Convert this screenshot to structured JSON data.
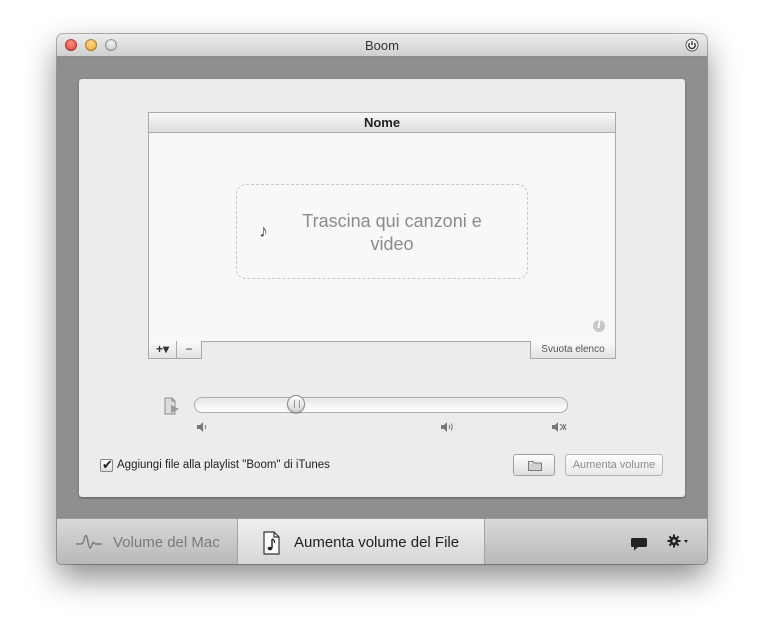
{
  "window": {
    "title": "Boom"
  },
  "table": {
    "column_header": "Nome",
    "drop_hint": "Trascina qui canzoni e video",
    "add_label": "+▾",
    "remove_label": "−",
    "clear_label": "Svuota elenco"
  },
  "volume": {
    "level": 0.26
  },
  "options": {
    "playlist_checkbox_label": "Aggiungi file alla playlist \"Boom\" di iTunes",
    "playlist_checked": true
  },
  "actions": {
    "boost_label": "Aumenta volume"
  },
  "tabs": [
    {
      "label": "Volume del Mac",
      "selected": false
    },
    {
      "label": "Aumenta volume del File",
      "selected": true
    }
  ],
  "icons": {
    "note": "♪",
    "info": "i",
    "check": "✔"
  },
  "colors": {
    "accent_red": "#d8352a",
    "accent_yellow": "#e5a120"
  }
}
